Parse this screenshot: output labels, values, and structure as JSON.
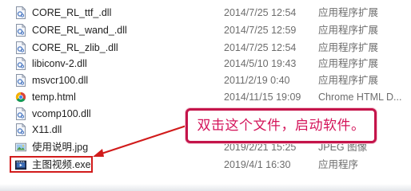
{
  "files": [
    {
      "name": "CORE_RL_ttf_.dll",
      "date": "2014/7/25 12:54",
      "type": "应用程序扩展",
      "icon": "dll-file-icon"
    },
    {
      "name": "CORE_RL_wand_.dll",
      "date": "2014/7/25 12:59",
      "type": "应用程序扩展",
      "icon": "dll-file-icon"
    },
    {
      "name": "CORE_RL_zlib_.dll",
      "date": "2014/7/25 12:54",
      "type": "应用程序扩展",
      "icon": "dll-file-icon"
    },
    {
      "name": "libiconv-2.dll",
      "date": "2014/5/10 19:43",
      "type": "应用程序扩展",
      "icon": "dll-file-icon"
    },
    {
      "name": "msvcr100.dll",
      "date": "2011/2/19 0:40",
      "type": "应用程序扩展",
      "icon": "dll-file-icon"
    },
    {
      "name": "temp.html",
      "date": "2014/11/15 19:09",
      "type": "Chrome HTML D...",
      "icon": "chrome-icon"
    },
    {
      "name": "vcomp100.dll",
      "date": "",
      "type": "",
      "icon": "dll-file-icon"
    },
    {
      "name": "X11.dll",
      "date": "",
      "type": "",
      "icon": "dll-file-icon"
    },
    {
      "name": "使用说明.jpg",
      "date": "2019/2/21 15:25",
      "type": "JPEG 图像",
      "icon": "image-file-icon"
    },
    {
      "name": "主图视频.exe",
      "date": "2019/4/1 16:30",
      "type": "应用程序",
      "icon": "exe-file-icon"
    }
  ],
  "callout": {
    "text": "双击这个文件，启动软件。"
  },
  "colors": {
    "annotation_red": "#d11b1b",
    "callout_border": "#c4144a",
    "callout_text": "#d4145a"
  }
}
